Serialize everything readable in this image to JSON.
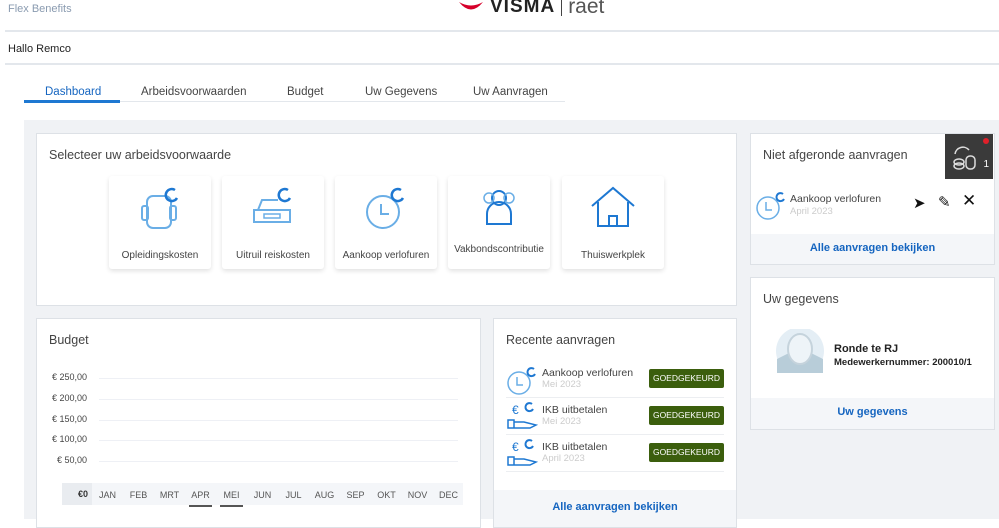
{
  "header": {
    "app_title": "Flex Benefits",
    "logo_brand": "VISMA",
    "logo_sub": "raet",
    "greeting": "Hallo Remco"
  },
  "tabs": [
    {
      "label": "Dashboard",
      "active": true
    },
    {
      "label": "Arbeidsvoorwaarden"
    },
    {
      "label": "Budget"
    },
    {
      "label": "Uw Gegevens"
    },
    {
      "label": "Uw Aanvragen"
    }
  ],
  "select": {
    "title": "Selecteer uw arbeidsvoorwaarde",
    "tiles": [
      {
        "label": "Opleidingskosten",
        "icon": "backpack-icon"
      },
      {
        "label": "Uitruil reiskosten",
        "icon": "car-icon"
      },
      {
        "label": "Aankoop verlofuren",
        "icon": "clock-icon"
      },
      {
        "label": "Vakbondscontributie",
        "icon": "people-icon"
      },
      {
        "label": "Thuiswerkplek",
        "icon": "house-icon"
      }
    ]
  },
  "budget": {
    "title": "Budget"
  },
  "chart_data": {
    "type": "bar",
    "title": "Budget",
    "categories": [
      "JAN",
      "FEB",
      "MRT",
      "APR",
      "MEI",
      "JUN",
      "JUL",
      "AUG",
      "SEP",
      "OKT",
      "NOV",
      "DEC"
    ],
    "values": [
      0,
      0,
      0,
      0,
      0,
      0,
      0,
      0,
      0,
      0,
      0,
      0
    ],
    "yticks": [
      "€ 50,00",
      "€ 100,00",
      "€ 150,00",
      "€ 200,00",
      "€ 250,00"
    ],
    "zero_label": "€0",
    "ylim": [
      0,
      250
    ],
    "highlighted": [
      "APR",
      "MEI"
    ]
  },
  "recent": {
    "title": "Recente aanvragen",
    "items": [
      {
        "name": "Aankoop verlofuren",
        "date": "Mei 2023",
        "status": "GOEDGEKEURD",
        "icon": "clock-icon"
      },
      {
        "name": "IKB uitbetalen",
        "date": "Mei 2023",
        "status": "GOEDGEKEURD",
        "icon": "euro-hand-icon"
      },
      {
        "name": "IKB uitbetalen",
        "date": "April 2023",
        "status": "GOEDGEKEURD",
        "icon": "euro-hand-icon"
      }
    ],
    "link": "Alle aanvragen bekijken"
  },
  "pending": {
    "title": "Niet afgeronde aanvragen",
    "badge_count": "1",
    "item": {
      "name": "Aankoop verlofuren",
      "date": "April 2023"
    },
    "link": "Alle aanvragen bekijken"
  },
  "profile": {
    "title": "Uw gegevens",
    "name": "Ronde te RJ",
    "employee_number": "Medewerkernummer: 200010/1",
    "link": "Uw gegevens"
  },
  "colors": {
    "accent": "#1565c0",
    "approved": "#3b5e0d",
    "badge_bg": "#3a3a3a"
  }
}
